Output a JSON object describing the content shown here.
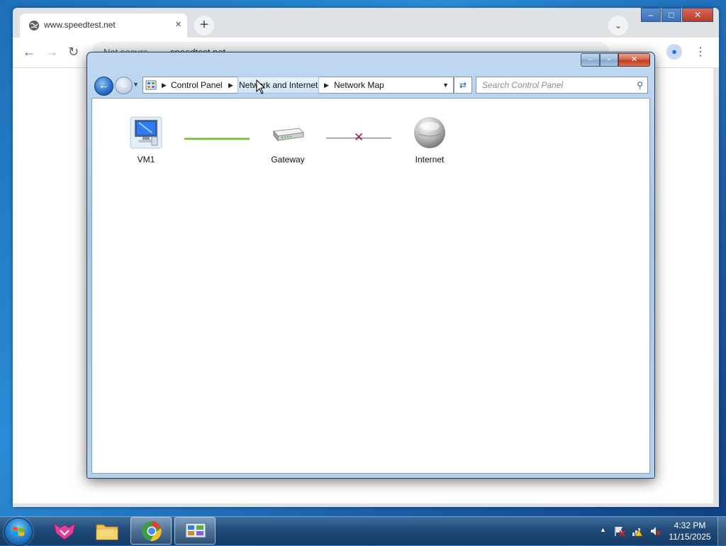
{
  "browser": {
    "tab_title": "www.speedtest.net",
    "tab_close": "×",
    "new_tab": "+",
    "tab_search": "⌄",
    "security": "Not secure",
    "url": "speedtest.net",
    "minimize": "–",
    "restore": "□",
    "close": "✕"
  },
  "control_panel": {
    "minimize": "–",
    "restore": "▫",
    "close": "✕",
    "breadcrumb": [
      "Control Panel",
      "Network and Internet",
      "Network Map"
    ],
    "search_placeholder": "Search Control Panel",
    "nodes": [
      {
        "label": "VM1",
        "icon": "computer-icon"
      },
      {
        "label": "Gateway",
        "icon": "router-icon"
      },
      {
        "label": "Internet",
        "icon": "globe-icon"
      }
    ],
    "links": [
      {
        "from": "VM1",
        "to": "Gateway",
        "status": "connected",
        "color": "#6fbf3a"
      },
      {
        "from": "Gateway",
        "to": "Internet",
        "status": "disconnected",
        "color": "#b01530"
      }
    ]
  },
  "taskbar": {
    "items": [
      "start-button",
      "file-explorer",
      "chrome",
      "control-panel"
    ],
    "clock": {
      "time": "4:32 PM",
      "date": "11/15/2025"
    }
  }
}
